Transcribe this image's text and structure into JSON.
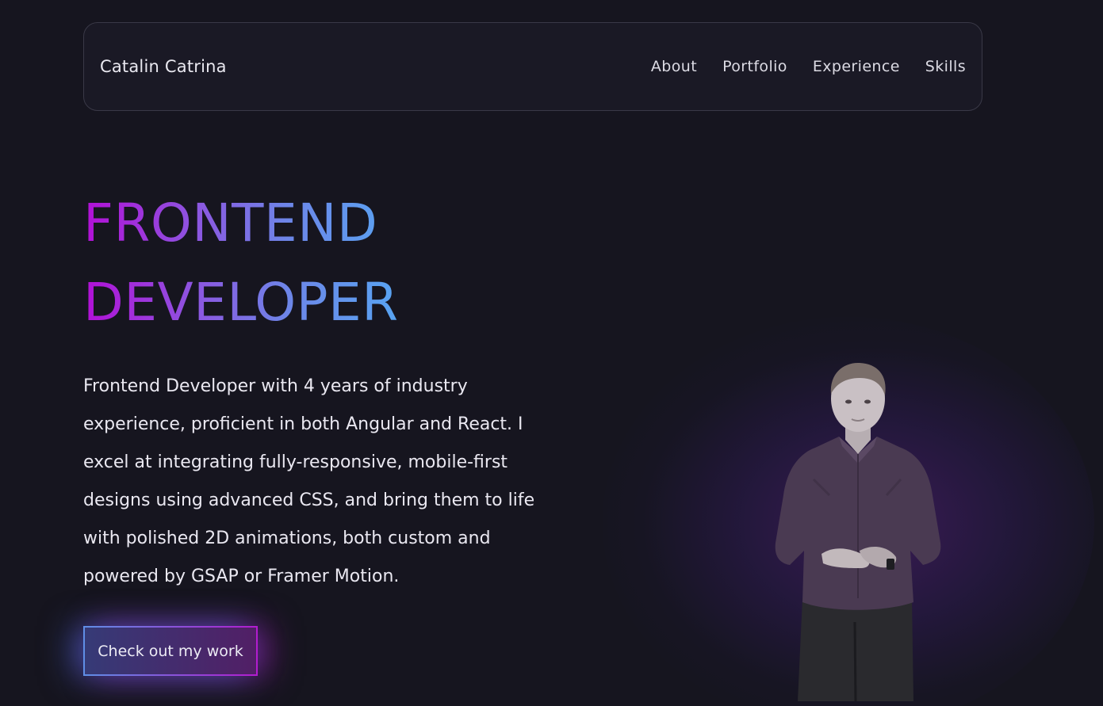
{
  "navbar": {
    "brand": "Catalin Catrina",
    "links": [
      "About",
      "Portfolio",
      "Experience",
      "Skills"
    ]
  },
  "hero": {
    "title_line1": "FRONTEND",
    "title_line2": "DEVELOPER",
    "description": "Frontend Developer with 4 years of industry experience, proficient in both Angular and React. I excel at integrating fully-responsive, mobile-first designs using advanced CSS, and bring them to life with polished 2D animations, both custom and powered by GSAP or Framer Motion.",
    "cta_label": "Check out my work"
  },
  "colors": {
    "background": "#16151f",
    "gradient_start": "#b20fd6",
    "gradient_end": "#58a4f2"
  }
}
